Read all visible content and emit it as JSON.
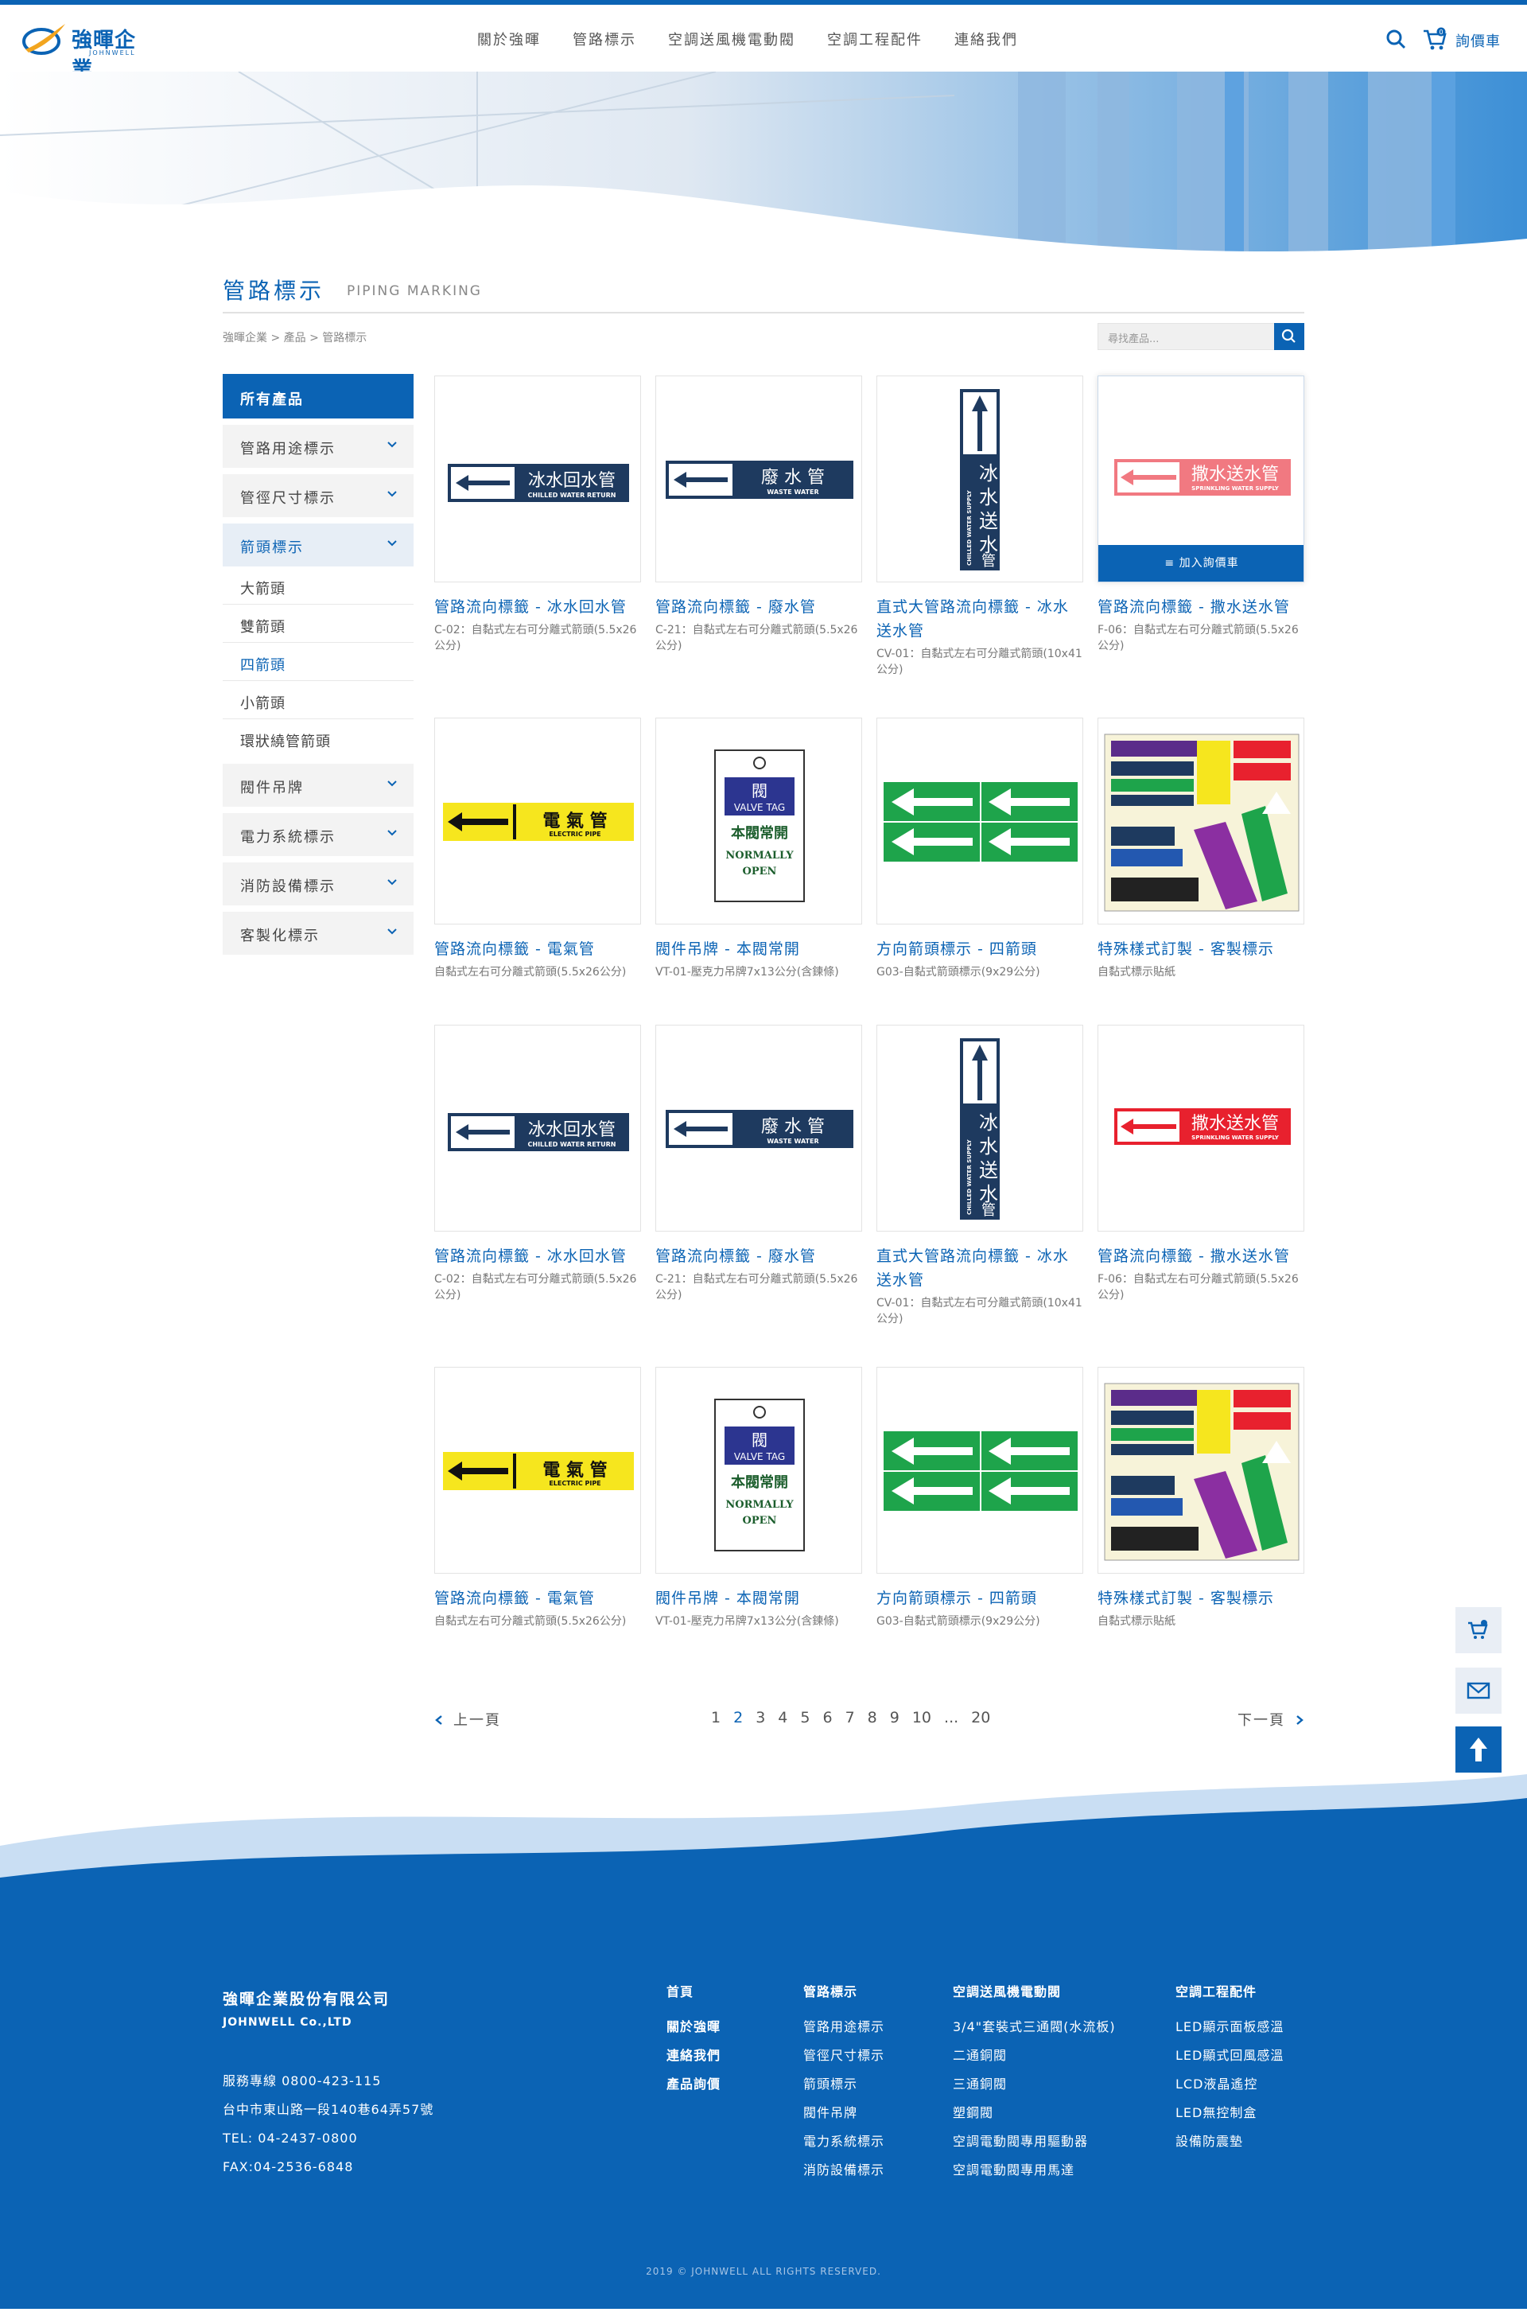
{
  "header": {
    "logo_text": "強暉企業",
    "logo_sub": "JOHNWELL",
    "nav": [
      "關於強暉",
      "管路標示",
      "空調送風機電動閥",
      "空調工程配件",
      "連絡我們"
    ],
    "cart_label": "詢價車",
    "cart_count": "0"
  },
  "page": {
    "title": "管路標示",
    "title_en": "PIPING MARKING",
    "breadcrumb": "強暉企業 > 產品 > 管路標示",
    "search_placeholder": "尋找產品..."
  },
  "sidebar": {
    "head": "所有產品",
    "items_top": [
      "管路用途標示",
      "管徑尺寸標示"
    ],
    "active": "箭頭標示",
    "sub_items": [
      "大箭頭",
      "雙箭頭",
      "四箭頭",
      "小箭頭",
      "環狀繞管箭頭"
    ],
    "sub_active_index": 2,
    "items_bottom": [
      "閥件吊牌",
      "電力系統標示",
      "消防設備標示",
      "客製化標示"
    ]
  },
  "products": [
    {
      "name": "管路流向標籤 - 冰水回水管",
      "desc": "C-02：自黏式左右可分離式箭頭(5.5x26公分)"
    },
    {
      "name": "管路流向標籤 - 廢水管",
      "desc": "C-21：自黏式左右可分離式箭頭(5.5x26公分)"
    },
    {
      "name": "直式大管路流向標籤 - 冰水送水管",
      "desc": "CV-01：自黏式左右可分離式箭頭(10x41公分)"
    },
    {
      "name": "管路流向標籤 - 撒水送水管",
      "desc": "F-06：自黏式左右可分離式箭頭(5.5x26公分)"
    },
    {
      "name": "管路流向標籤 - 電氣管",
      "desc": "自黏式左右可分離式箭頭(5.5x26公分)"
    },
    {
      "name": "閥件吊牌 - 本閥常開",
      "desc": "VT-01-壓克力吊牌7x13公分(含鍊條)"
    },
    {
      "name": "方向箭頭標示 - 四箭頭",
      "desc": "G03-自黏式箭頭標示(9x29公分)"
    },
    {
      "name": "特殊樣式訂製 - 客製標示",
      "desc": "自黏式標示貼紙"
    }
  ],
  "add_to_cart_label": "≡ 加入詢價車",
  "labels": {
    "chilled_return": "冰水回水管",
    "chilled_return_en": "CHILLED WATER RETURN",
    "waste": "廢 水 管",
    "waste_en": "WASTE WATER",
    "chilled_supply": "冰水送水管",
    "chilled_supply_en": "CHILLED WATER SUPPLY",
    "sprinkler": "撒水送水管",
    "sprinkler_en": "SPRINKLING WATER SUPPLY",
    "electric": "電 氣 管",
    "electric_en": "ELECTRIC PIPE",
    "valve_title": "閥",
    "valve_en": "VALVE TAG",
    "valve_status": "本閥常開",
    "valve_status_en1": "NORMALLY",
    "valve_status_en2": "OPEN"
  },
  "pager": {
    "prev": "上一頁",
    "next": "下一頁",
    "pages": [
      "1",
      "2",
      "3",
      "4",
      "5",
      "6",
      "7",
      "8",
      "9",
      "10",
      "...",
      "20"
    ],
    "current_index": 1
  },
  "footer": {
    "company": "強暉企業股份有限公司",
    "company_en": "JOHNWELL Co.,LTD",
    "contact": [
      "服務專線 0800-423-115",
      "台中市東山路一段140巷64弄57號",
      "TEL: 04-2437-0800",
      "FAX:04-2536-6848"
    ],
    "col1": [
      "首頁",
      "關於強暉",
      "連絡我們",
      "產品詢價"
    ],
    "col2_head": "管路標示",
    "col2": [
      "管路用途標示",
      "管徑尺寸標示",
      "箭頭標示",
      "閥件吊牌",
      "電力系統標示",
      "消防設備標示"
    ],
    "col3_head": "空調送風機電動閥",
    "col3": [
      "3/4\"套裝式三通閥(水流板)",
      "二通銅閥",
      "三通銅閥",
      "塑鋼閥",
      "空調電動閥專用驅動器",
      "空調電動閥專用馬達"
    ],
    "col4_head": "空調工程配件",
    "col4": [
      "LED顯示面板感溫",
      "LED顯式回風感溫",
      "LCD液晶遙控",
      "LED無控制盒",
      "設備防震墊"
    ],
    "copyright": "2019 © JOHNWELL ALL RIGHTS RESERVED."
  },
  "colors": {
    "brand": "#0b63b4",
    "navy": "#1e3a5f",
    "sprinkler": "#e8212e",
    "electric": "#f6e61e",
    "green": "#1ea44b"
  }
}
